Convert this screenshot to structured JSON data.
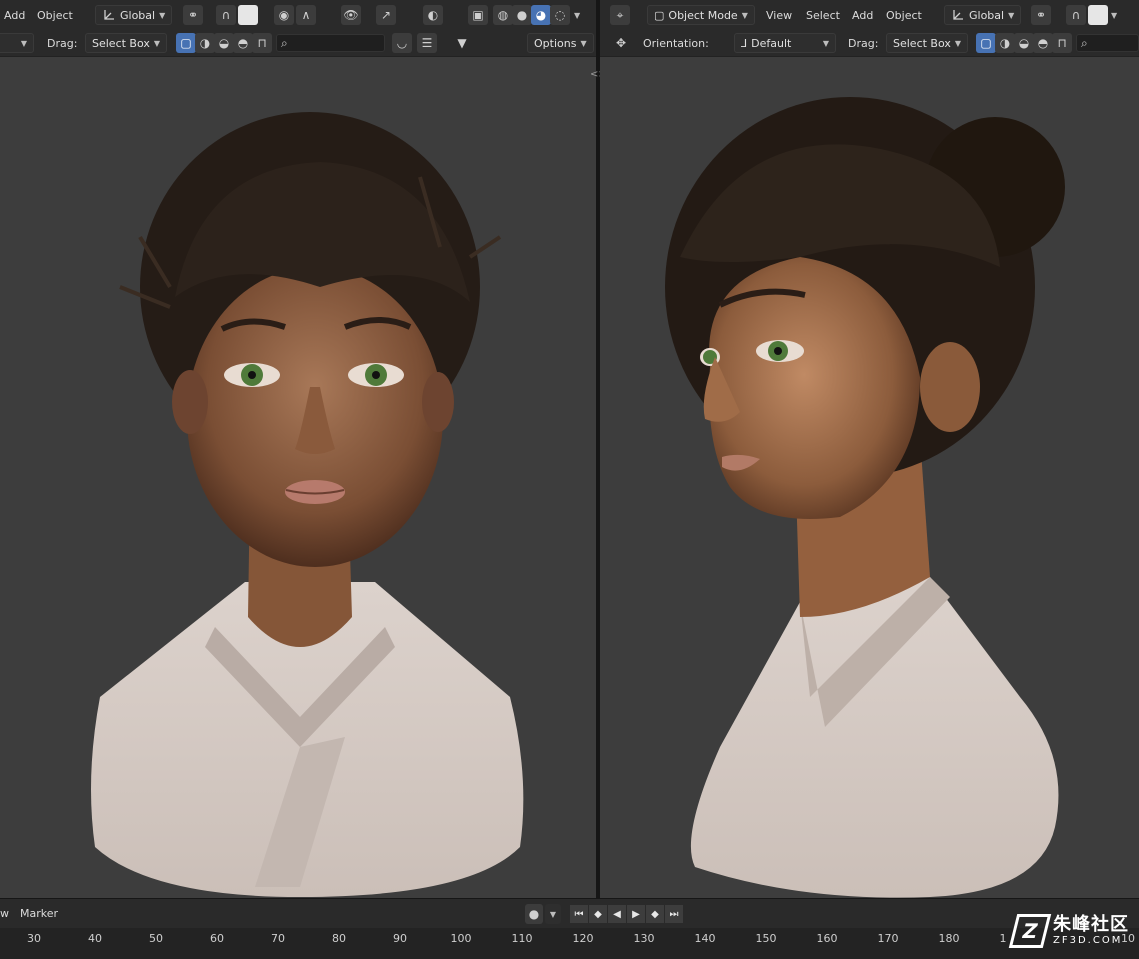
{
  "left_header": {
    "menu": [
      "Add",
      "Object"
    ],
    "orientation": "Global",
    "drag_label": "Drag:",
    "select_mode": "Select Box",
    "options_label": "Options"
  },
  "right_header": {
    "mode": "Object Mode",
    "menu": [
      "View",
      "Select",
      "Add",
      "Object"
    ],
    "orientation": "Global",
    "orientation_label": "Orientation:",
    "orientation_value": "Default",
    "drag_label": "Drag:",
    "select_mode": "Select Box"
  },
  "timeline": {
    "menu_partial": "w",
    "marker_label": "Marker",
    "ticks": [
      "30",
      "40",
      "50",
      "60",
      "70",
      "80",
      "90",
      "100",
      "110",
      "120",
      "130",
      "140",
      "150",
      "160",
      "170",
      "180",
      "1",
      "10"
    ]
  },
  "icons": {
    "orientation": "transform-axes-icon",
    "snap": "magnet-icon",
    "proportional": "proportional-edit-icon",
    "overlay": "overlay-icon",
    "gizmo": "gizmo-icon",
    "shading": [
      "wireframe-icon",
      "solid-icon",
      "material-preview-icon",
      "rendered-icon"
    ],
    "filter": "filter-icon",
    "search": "search-icon",
    "record": "record-icon"
  },
  "watermark": {
    "cn": "朱峰社区",
    "en": "ZF3D.COM"
  },
  "colors": {
    "accent": "#4772b3",
    "viewport_bg": "#3d3d3d",
    "header_bg": "#2a2a2a"
  }
}
